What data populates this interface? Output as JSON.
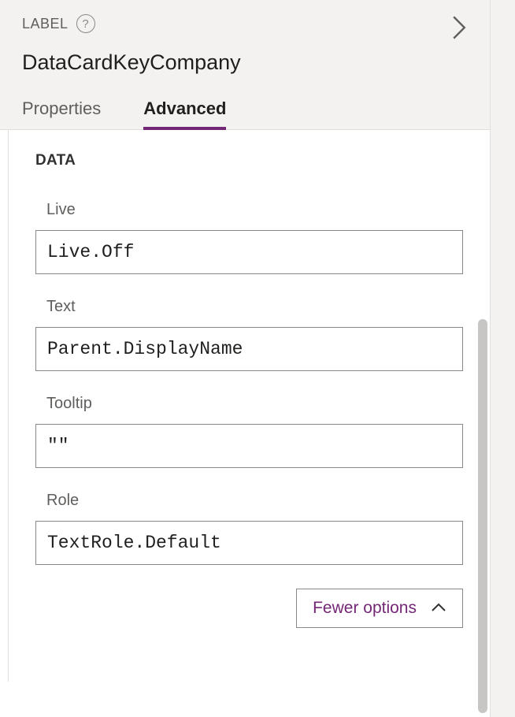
{
  "header": {
    "label": "LABEL",
    "control_name": "DataCardKeyCompany"
  },
  "tabs": {
    "properties": "Properties",
    "advanced": "Advanced"
  },
  "section": {
    "title": "DATA"
  },
  "fields": {
    "live": {
      "label": "Live",
      "value": "Live.Off"
    },
    "text": {
      "label": "Text",
      "value": "Parent.DisplayName"
    },
    "tooltip": {
      "label": "Tooltip",
      "value": "\"\""
    },
    "role": {
      "label": "Role",
      "value": "TextRole.Default"
    }
  },
  "toggle": {
    "fewer_label": "Fewer options"
  }
}
